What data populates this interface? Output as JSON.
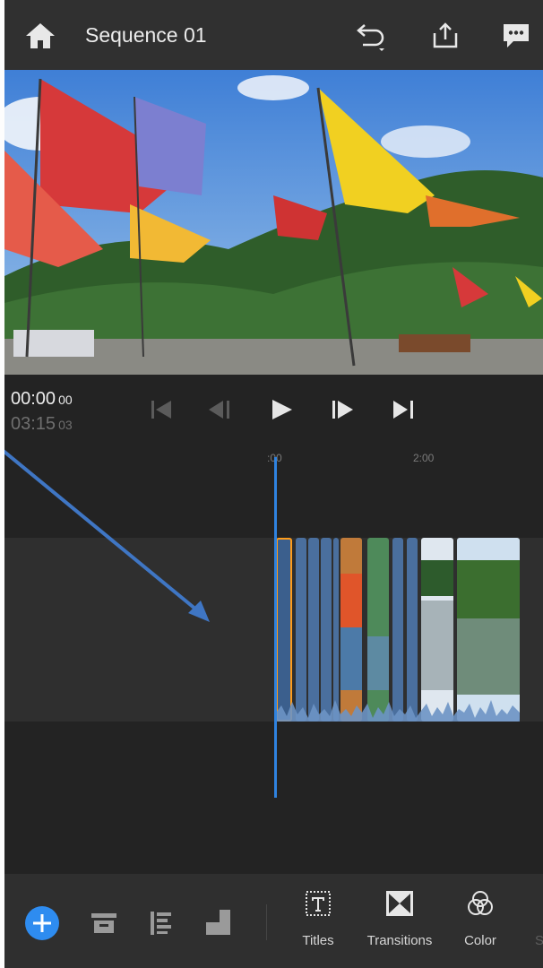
{
  "header": {
    "title": "Sequence 01",
    "home_icon": "home-icon",
    "undo_icon": "undo-icon",
    "share_icon": "share-icon",
    "feedback_icon": "feedback-chat-icon"
  },
  "preview": {
    "description_icon": "video-preview"
  },
  "transport": {
    "current_time": "00:00",
    "current_frames": "00",
    "total_time": "03:15",
    "total_frames": "03",
    "buttons": [
      "skip-to-start-icon",
      "step-back-icon",
      "play-icon",
      "step-forward-icon",
      "skip-to-end-icon"
    ]
  },
  "ruler": {
    "ticks": [
      ":00",
      "2:00"
    ]
  },
  "toolbar": {
    "items": [
      {
        "label": "Titles",
        "icon": "titles-icon"
      },
      {
        "label": "Transitions",
        "icon": "transitions-icon"
      },
      {
        "label": "Color",
        "icon": "color-icon"
      },
      {
        "label": "S",
        "icon": "partial-item"
      }
    ],
    "left_icons": [
      "add-media-icon",
      "storage-icon",
      "align-left-icon",
      "aspect-icon"
    ]
  },
  "colors": {
    "accent": "#2e8cf0",
    "selection": "#ff9c1a",
    "clip": "#4a6f9e"
  }
}
